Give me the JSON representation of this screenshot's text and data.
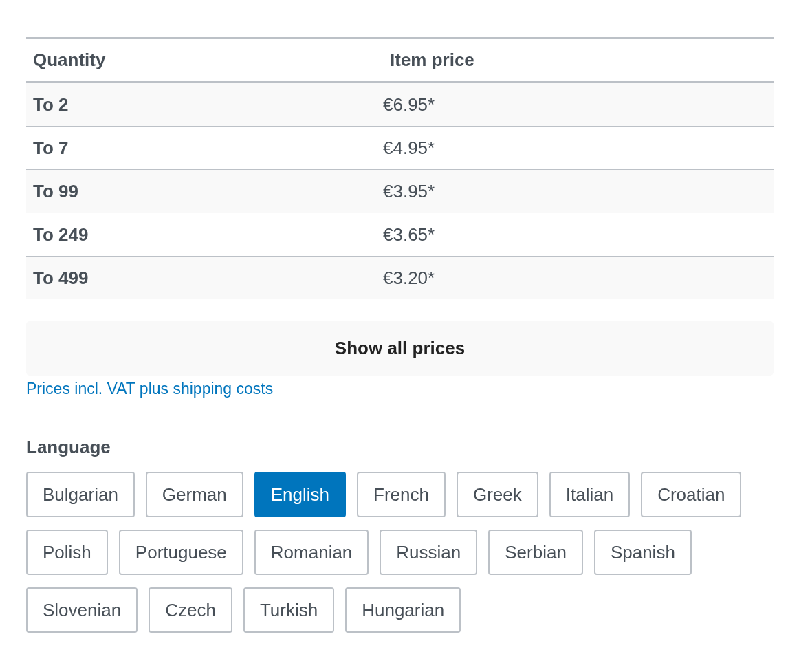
{
  "price_table": {
    "columns": [
      "Quantity",
      "Item price"
    ],
    "rows": [
      {
        "quantity": "To 2",
        "price": "€6.95*"
      },
      {
        "quantity": "To 7",
        "price": "€4.95*"
      },
      {
        "quantity": "To 99",
        "price": "€3.95*"
      },
      {
        "quantity": "To 249",
        "price": "€3.65*"
      },
      {
        "quantity": "To 499",
        "price": "€3.20*"
      }
    ]
  },
  "show_all_button": "Show all prices",
  "vat_link": "Prices incl. VAT plus shipping costs",
  "language": {
    "label": "Language",
    "options": [
      {
        "label": "Bulgarian",
        "selected": false
      },
      {
        "label": "German",
        "selected": false
      },
      {
        "label": "English",
        "selected": true
      },
      {
        "label": "French",
        "selected": false
      },
      {
        "label": "Greek",
        "selected": false
      },
      {
        "label": "Italian",
        "selected": false
      },
      {
        "label": "Croatian",
        "selected": false
      },
      {
        "label": "Polish",
        "selected": false
      },
      {
        "label": "Portuguese",
        "selected": false
      },
      {
        "label": "Romanian",
        "selected": false
      },
      {
        "label": "Russian",
        "selected": false
      },
      {
        "label": "Serbian",
        "selected": false
      },
      {
        "label": "Spanish",
        "selected": false
      },
      {
        "label": "Slovenian",
        "selected": false
      },
      {
        "label": "Czech",
        "selected": false
      },
      {
        "label": "Turkish",
        "selected": false
      },
      {
        "label": "Hungarian",
        "selected": false
      }
    ]
  }
}
